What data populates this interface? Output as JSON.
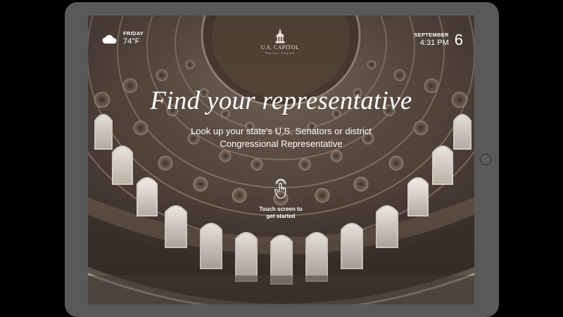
{
  "weather": {
    "day": "FRIDAY",
    "temperature": "74°F",
    "icon": "cloud-icon"
  },
  "datetime": {
    "month": "SEPTEMBER",
    "time": "4:31 PM",
    "day_number": "6"
  },
  "logo": {
    "name": "U.S. CAPITOL",
    "subtitle": "Visitor Center",
    "icon": "capitol-dome-icon"
  },
  "headline": "Find your representative",
  "subhead": {
    "line1": "Look up your state's U.S. Senators or district",
    "line2": "Congressional Representative"
  },
  "touch_prompt": {
    "line1": "Touch screen to",
    "line2": "get started",
    "icon": "tap-hand-icon"
  }
}
